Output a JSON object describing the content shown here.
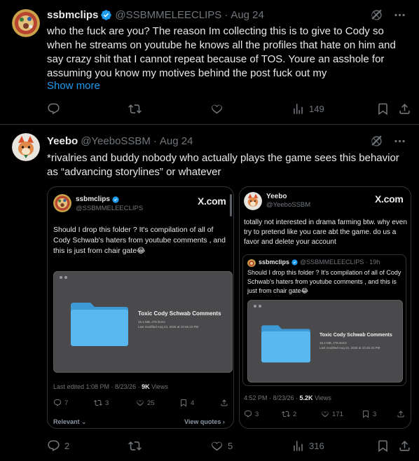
{
  "tweets": [
    {
      "name": "ssbmclips",
      "handle": "@SSBMMELEECLIPS",
      "separator": "·",
      "date": "Aug 24",
      "text": "who the fuck are you? The reason Im collecting this is to give to Cody so when he streams on youtube he knows all the profiles that hate on him and say crazy shit that I cannot repeat because of TOS. Youre an asshole for assuming you know my motives behind the post fuck out my",
      "show_more": "Show more",
      "reply_count": "",
      "retweet_count": "",
      "like_count": "",
      "views": "149"
    },
    {
      "name": "Yeebo",
      "handle": "@YeeboSSBM",
      "separator": "·",
      "date": "Aug 24",
      "text": "*rivalries and buddy nobody who actually plays the game sees this behavior as “advancing storylines” or whatever",
      "reply_count": "2",
      "retweet_count": "",
      "like_count": "5",
      "views": "316"
    }
  ],
  "embed_a": {
    "name": "ssbmclips",
    "handle": "@SSBMMELEECLIPS",
    "site": "X.com",
    "text": "Should I drop this folder ? It's compilation of all of Cody Schwab's  haters from youtube comments , and this is just from chair gate😂",
    "folder_title": "Toxic Cody Schwab Comments",
    "folder_size": "15.4 MB, 276 items",
    "folder_modified": "Last modified Aug 23, 2026 at 10:46 22 PM",
    "meta_prefix": "Last edited 1:08 PM · 8/23/26 · ",
    "meta_views": "9K",
    "meta_suffix": " Views",
    "replies": "7",
    "retweets": "3",
    "likes": "25",
    "bookmarks": "4",
    "footer_left": "Relevant ⌄",
    "footer_right": "View quotes ›"
  },
  "embed_b": {
    "name": "Yeebo",
    "handle": "@YeeboSSBM",
    "site": "X.com",
    "text": "totally not interested in drama farming btw. why even try to pretend like you care abt the game. do us a favor and delete your account",
    "quoted_name": "ssbmclips",
    "quoted_handle": "@SSBMMELEECLIPS · 19h",
    "quoted_text": "Should I drop this folder ? It's compilation of all of Cody Schwab's  haters from youtube comments , and this is just from chair gate😂",
    "folder_title": "Toxic Cody Schwab Comments",
    "folder_size": "15.4 MB, 276 items",
    "folder_modified": "Last modified Aug 23, 2026 at 10:46 22 PM",
    "meta_prefix": "4:52 PM · 8/23/26 · ",
    "meta_views": "5.2K",
    "meta_suffix": " Views",
    "replies": "3",
    "retweets": "2",
    "likes": "171",
    "bookmarks": "3"
  },
  "colors": {
    "background": "#000000",
    "text": "#e7e9ea",
    "muted": "#71767b",
    "link": "#1d9bf0",
    "verified": "#1d9bf0",
    "border": "#2f3336",
    "folder": "#5ab8f0"
  },
  "icons": [
    "verified-badge-icon",
    "grok-icon",
    "more-icon",
    "reply-icon",
    "retweet-icon",
    "like-icon",
    "views-icon",
    "bookmark-icon",
    "share-icon",
    "folder-icon"
  ]
}
